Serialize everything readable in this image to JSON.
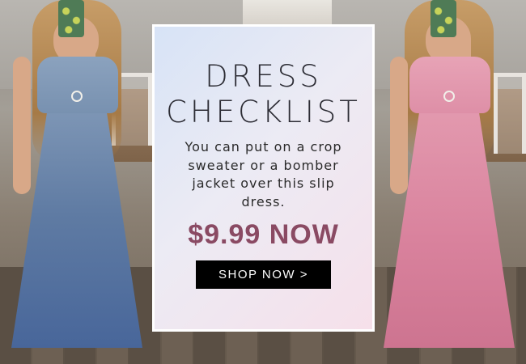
{
  "card": {
    "title_line1": "DRESS",
    "title_line2": "CHECKLIST",
    "description": "You can put on a crop sweater or a bomber jacket over this slip dress.",
    "price": "$9.99 NOW",
    "button_label": "SHOP NOW >"
  },
  "colors": {
    "price_text": "#8a4a63",
    "button_bg": "#000000",
    "button_text": "#ffffff",
    "left_dress": "#5f7ba3",
    "right_dress": "#d9829d"
  }
}
